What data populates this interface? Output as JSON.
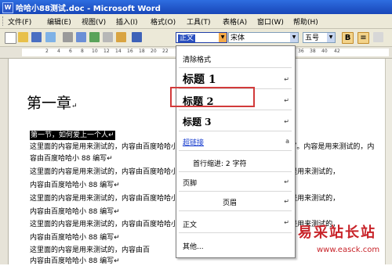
{
  "window": {
    "title": "哈哈小88测试.doc - Microsoft Word",
    "app_icon": "W"
  },
  "menu": {
    "items": [
      "文件(F)",
      "编辑(E)",
      "视图(V)",
      "插入(I)",
      "格式(O)",
      "工具(T)",
      "表格(A)",
      "窗口(W)",
      "帮助(H)"
    ]
  },
  "toolbar": {
    "style_value": "正文",
    "font_value": "宋体",
    "size_value": "五号",
    "bold_label": "B",
    "align_label": "≡"
  },
  "ruler": {
    "ticks": [
      "2",
      "4",
      "6",
      "8",
      "10",
      "12",
      "14",
      "16",
      "18",
      "20",
      "22",
      "24",
      "26",
      "28",
      "30",
      "32",
      "34",
      "36",
      "38",
      "40",
      "42"
    ]
  },
  "document": {
    "heading": "第一章",
    "heading_mark": "↵",
    "selected_line": "第一节，如何爱上一个人↵",
    "lines": [
      "这里面的内容是用来测试的，内容由百度哈哈小 88 编写，内容由百度哈哈小 88 编写。内容是用来测试的，内",
      "容由百度哈哈小 88 编写↵",
      "      这里面的内容是用来测试的，内容由百度哈哈小 88 编写。内容是用来测试的，内容是用来测试的，",
      "内容由百度哈哈小 88 编写↵",
      "      这里面的内容是用来测试的，内容由百度哈哈小 88 编写。内容是用来测试的，内容是用来测试的，",
      "内容由百度哈哈小 88 编写↵",
      "      这里面的内容是用来测试的，内容由百度哈哈小 88 编写。内容是用来测试的，内容是用来测试的，",
      "内容由百度哈哈小 88 编写↵",
      "      这里面的内容是用来测试的，内容由百",
      "内容由百度哈哈小 88 编写↵"
    ]
  },
  "style_panel": {
    "clear": "清除格式",
    "h1": "标题 1",
    "h2": "标题 2",
    "h3": "标题 3",
    "link": "超链接",
    "link_mark": "a",
    "indent": "首行缩进:  2 字符",
    "footer": "页脚",
    "header": "页眉",
    "normal": "正文",
    "more": "其他...",
    "para_mark": "↵"
  },
  "watermark": {
    "text": "易采站长站",
    "url": "www.easck.com"
  },
  "colors": {
    "title_bar": "#1f52c8",
    "highlight_border": "#d23a3a",
    "watermark": "#c8242a"
  }
}
